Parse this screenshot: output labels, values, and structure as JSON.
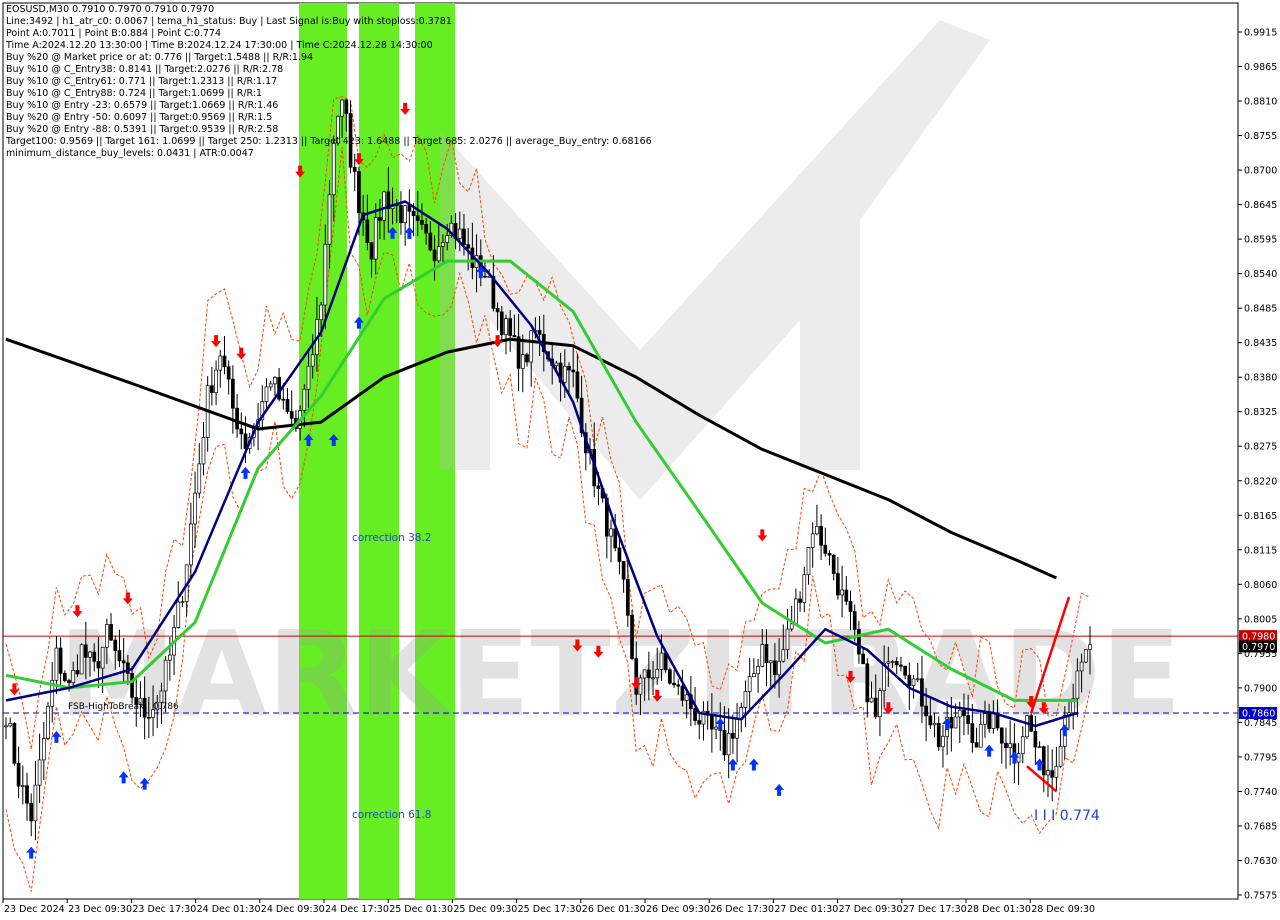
{
  "info_lines": [
    "EOSUSD,M30  0.7910 0.7970 0.7910 0.7970",
    "Line:3492 | h1_atr_c0: 0.0067 | tema_h1_status: Buy | Last Signal is:Buy with stoploss:0.3781",
    "Point A:0.7011 | Point B:0.884 | Point C:0.774",
    "Time A:2024.12.20 13:30:00 | Time B:2024.12.24 17:30:00 | Time C:2024.12.28 14:30:00",
    "Buy %20 @ Market price or at: 0.776 || Target:1.5488 || R/R:1.94",
    "Buy %10 @ C_Entry38: 0.8141 || Target:2.0276 || R/R:2.78",
    "Buy %10 @ C_Entry61: 0.771 || Target:1.2313 || R/R:1.17",
    "Buy %10 @ C_Entry88: 0.724 || Target:1.0699 || R/R:1",
    "Buy %10 @ Entry -23: 0.6579 || Target:1.0669 || R/R:1.46",
    "Buy %20 @ Entry -50: 0.6097 || Target:0.9569 || R/R:1.5",
    "Buy %20 @ Entry -88: 0.5391 || Target:0.9539 || R/R:2.58",
    "Target100: 0.9569 || Target 161: 1.0699 || Target 250: 1.2313 || Target 423: 1.6488 || Target 685: 2.0276 || average_Buy_entry: 0.68166",
    "minimum_distance_buy_levels: 0.0431 | ATR:0.0047"
  ],
  "annotations": {
    "correction_38": "correction 38.2",
    "correction_61": "correction 61.8",
    "fsb_label": "FSB-HighToBreak | 0.786",
    "point_c_label": "I I I 0.774",
    "watermark": "MARKETZITRADE"
  },
  "price_tags": {
    "red_line_value": "0.7980",
    "current_value": "0.7970",
    "blue_line_value": "0.7860"
  },
  "colors": {
    "candle": "#000000",
    "bull_fill": "#ffffff",
    "ma_black": "#000000",
    "ma_green": "#33cc33",
    "ma_navy": "#000080",
    "envelope": "#ff4400",
    "buy_arrow": "#0033ff",
    "sell_arrow": "#ff0000",
    "highlight_band": "#66ee22",
    "red_level": "#cc0000",
    "blue_level": "#0000cc",
    "annot_blue": "#2244cc"
  },
  "chart_data": {
    "type": "candlestick",
    "symbol": "EOSUSD",
    "timeframe": "M30",
    "ylim": [
      0.7575,
      0.9915
    ],
    "y_ticks": [
      "0.9915",
      "0.9865",
      "0.8810",
      "0.8755",
      "0.8700",
      "0.8645",
      "0.8595",
      "0.8540",
      "0.8485",
      "0.8435",
      "0.8380",
      "0.8325",
      "0.8275",
      "0.8220",
      "0.8165",
      "0.8115",
      "0.8060",
      "0.8005",
      "0.7955",
      "0.7900",
      "0.7845",
      "0.7795",
      "0.7740",
      "0.7685",
      "0.7630",
      "0.7575"
    ],
    "x_ticks": [
      "23 Dec 2024",
      "23 Dec 09:30",
      "23 Dec 17:30",
      "24 Dec 01:30",
      "24 Dec 09:30",
      "24 Dec 17:30",
      "25 Dec 01:30",
      "25 Dec 09:30",
      "25 Dec 17:30",
      "26 Dec 01:30",
      "26 Dec 09:30",
      "26 Dec 17:30",
      "27 Dec 01:30",
      "27 Dec 09:30",
      "27 Dec 17:30",
      "28 Dec 01:30",
      "28 Dec 09:30"
    ],
    "levels": {
      "red_line": 0.798,
      "blue_line": 0.786,
      "fsb_high_to_break": 0.786
    },
    "points": {
      "A": 0.7011,
      "B": 0.884,
      "C": 0.774
    },
    "price_path": [
      [
        0,
        0.786
      ],
      [
        3,
        0.776
      ],
      [
        6,
        0.77
      ],
      [
        9,
        0.782
      ],
      [
        12,
        0.795
      ],
      [
        15,
        0.79
      ],
      [
        18,
        0.796
      ],
      [
        21,
        0.793
      ],
      [
        24,
        0.798
      ],
      [
        27,
        0.794
      ],
      [
        30,
        0.789
      ],
      [
        33,
        0.786
      ],
      [
        36,
        0.788
      ],
      [
        39,
        0.795
      ],
      [
        42,
        0.805
      ],
      [
        45,
        0.82
      ],
      [
        48,
        0.835
      ],
      [
        51,
        0.842
      ],
      [
        54,
        0.833
      ],
      [
        57,
        0.828
      ],
      [
        60,
        0.832
      ],
      [
        63,
        0.838
      ],
      [
        66,
        0.833
      ],
      [
        69,
        0.83
      ],
      [
        72,
        0.838
      ],
      [
        75,
        0.85
      ],
      [
        78,
        0.875
      ],
      [
        80,
        0.883
      ],
      [
        82,
        0.872
      ],
      [
        84,
        0.865
      ],
      [
        87,
        0.858
      ],
      [
        90,
        0.866
      ],
      [
        93,
        0.864
      ],
      [
        96,
        0.862
      ],
      [
        99,
        0.86
      ],
      [
        102,
        0.858
      ],
      [
        105,
        0.862
      ],
      [
        108,
        0.86
      ],
      [
        111,
        0.856
      ],
      [
        114,
        0.854
      ],
      [
        117,
        0.848
      ],
      [
        120,
        0.844
      ],
      [
        123,
        0.84
      ],
      [
        126,
        0.845
      ],
      [
        129,
        0.842
      ],
      [
        132,
        0.839
      ],
      [
        135,
        0.838
      ],
      [
        138,
        0.828
      ],
      [
        141,
        0.82
      ],
      [
        144,
        0.813
      ],
      [
        147,
        0.805
      ],
      [
        150,
        0.79
      ],
      [
        153,
        0.792
      ],
      [
        156,
        0.794
      ],
      [
        159,
        0.79
      ],
      [
        162,
        0.788
      ],
      [
        165,
        0.785
      ],
      [
        168,
        0.783
      ],
      [
        171,
        0.781
      ],
      [
        174,
        0.785
      ],
      [
        177,
        0.79
      ],
      [
        180,
        0.797
      ],
      [
        183,
        0.792
      ],
      [
        186,
        0.798
      ],
      [
        189,
        0.805
      ],
      [
        192,
        0.815
      ],
      [
        195,
        0.812
      ],
      [
        198,
        0.806
      ],
      [
        201,
        0.8
      ],
      [
        204,
        0.792
      ],
      [
        207,
        0.785
      ],
      [
        210,
        0.796
      ],
      [
        213,
        0.795
      ],
      [
        216,
        0.791
      ],
      [
        219,
        0.787
      ],
      [
        222,
        0.782
      ],
      [
        225,
        0.784
      ],
      [
        228,
        0.786
      ],
      [
        231,
        0.782
      ],
      [
        234,
        0.785
      ],
      [
        237,
        0.783
      ],
      [
        240,
        0.78
      ],
      [
        243,
        0.785
      ],
      [
        246,
        0.779
      ],
      [
        249,
        0.777
      ],
      [
        252,
        0.786
      ],
      [
        255,
        0.791
      ],
      [
        258,
        0.797
      ]
    ],
    "moving_averages": [
      {
        "name": "slow",
        "values": [
          [
            0,
            0.844
          ],
          [
            30,
            0.837
          ],
          [
            60,
            0.83
          ],
          [
            75,
            0.831
          ],
          [
            90,
            0.838
          ],
          [
            105,
            0.842
          ],
          [
            120,
            0.844
          ],
          [
            135,
            0.843
          ],
          [
            150,
            0.838
          ],
          [
            165,
            0.832
          ],
          [
            180,
            0.827
          ],
          [
            195,
            0.823
          ],
          [
            210,
            0.819
          ],
          [
            225,
            0.814
          ],
          [
            240,
            0.81
          ],
          [
            250,
            0.807
          ]
        ]
      },
      {
        "name": "medium",
        "values": [
          [
            0,
            0.792
          ],
          [
            15,
            0.79
          ],
          [
            30,
            0.791
          ],
          [
            45,
            0.8
          ],
          [
            60,
            0.824
          ],
          [
            75,
            0.835
          ],
          [
            90,
            0.85
          ],
          [
            105,
            0.856
          ],
          [
            120,
            0.856
          ],
          [
            135,
            0.848
          ],
          [
            150,
            0.831
          ],
          [
            165,
            0.817
          ],
          [
            180,
            0.803
          ],
          [
            195,
            0.797
          ],
          [
            210,
            0.799
          ],
          [
            225,
            0.793
          ],
          [
            240,
            0.788
          ],
          [
            255,
            0.788
          ]
        ]
      },
      {
        "name": "fast",
        "values": [
          [
            0,
            0.788
          ],
          [
            15,
            0.79
          ],
          [
            30,
            0.793
          ],
          [
            45,
            0.808
          ],
          [
            60,
            0.831
          ],
          [
            75,
            0.845
          ],
          [
            85,
            0.863
          ],
          [
            95,
            0.865
          ],
          [
            105,
            0.861
          ],
          [
            115,
            0.854
          ],
          [
            125,
            0.846
          ],
          [
            135,
            0.834
          ],
          [
            145,
            0.815
          ],
          [
            155,
            0.798
          ],
          [
            165,
            0.786
          ],
          [
            175,
            0.785
          ],
          [
            185,
            0.792
          ],
          [
            195,
            0.799
          ],
          [
            205,
            0.796
          ],
          [
            215,
            0.79
          ],
          [
            225,
            0.787
          ],
          [
            235,
            0.786
          ],
          [
            245,
            0.784
          ],
          [
            255,
            0.786
          ]
        ]
      }
    ],
    "signals": {
      "buy": [
        [
          6,
          0.766
        ],
        [
          12,
          0.784
        ],
        [
          28,
          0.778
        ],
        [
          33,
          0.777
        ],
        [
          57,
          0.825
        ],
        [
          72,
          0.83
        ],
        [
          78,
          0.83
        ],
        [
          84,
          0.848
        ],
        [
          92,
          0.862
        ],
        [
          96,
          0.862
        ],
        [
          113,
          0.856
        ],
        [
          170,
          0.786
        ],
        [
          173,
          0.78
        ],
        [
          178,
          0.78
        ],
        [
          184,
          0.776
        ],
        [
          224,
          0.786
        ],
        [
          234,
          0.782
        ],
        [
          240,
          0.781
        ],
        [
          246,
          0.78
        ],
        [
          252,
          0.785
        ]
      ],
      "sell": [
        [
          2,
          0.788
        ],
        [
          17,
          0.8
        ],
        [
          29,
          0.802
        ],
        [
          50,
          0.842
        ],
        [
          56,
          0.84
        ],
        [
          70,
          0.868
        ],
        [
          84,
          0.87
        ],
        [
          95,
          0.878
        ],
        [
          117,
          0.842
        ],
        [
          136,
          0.795
        ],
        [
          141,
          0.794
        ],
        [
          150,
          0.789
        ],
        [
          155,
          0.787
        ],
        [
          180,
          0.812
        ],
        [
          201,
          0.79
        ],
        [
          210,
          0.785
        ],
        [
          244,
          0.786
        ],
        [
          247,
          0.785
        ]
      ]
    }
  }
}
